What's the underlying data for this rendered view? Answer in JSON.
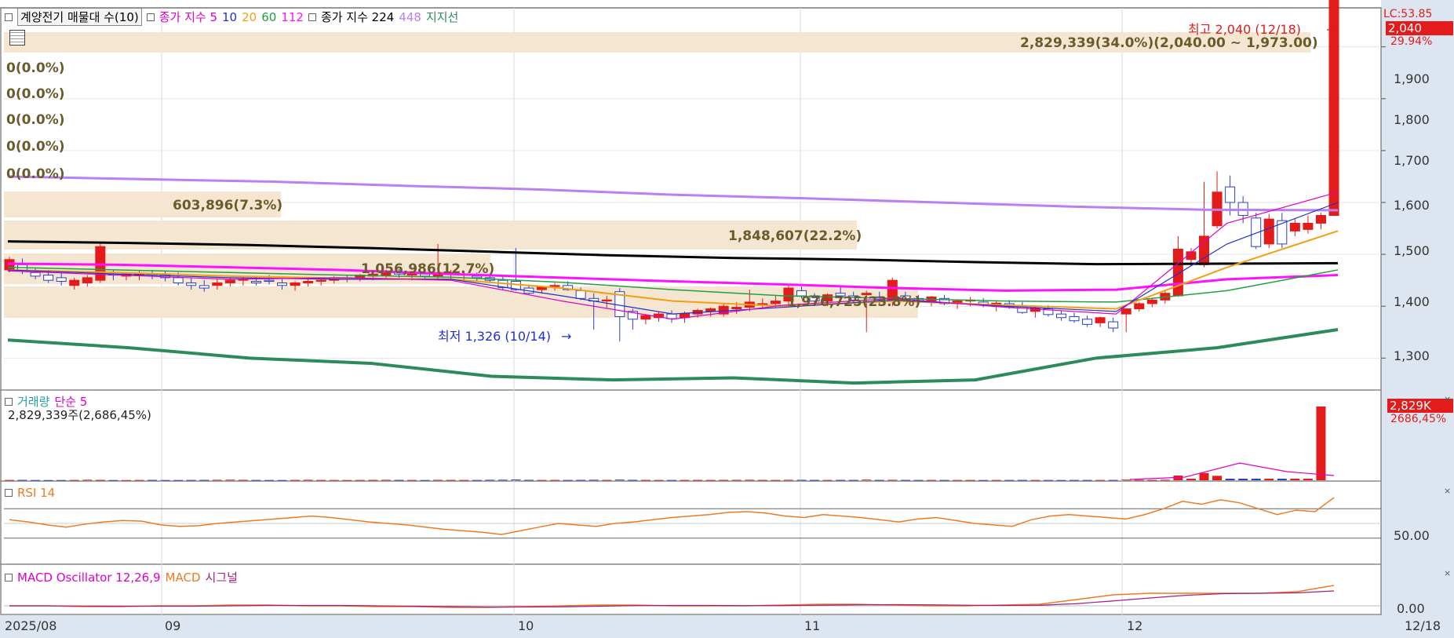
{
  "legend_top": {
    "item1": "계양전기 매물대 수(10)",
    "item2": "종가 지수 5",
    "item3": "10",
    "item4": "20",
    "item5": "60",
    "item6": "112",
    "item7": "종가 지수 224",
    "item8": "448",
    "item9": "지지선"
  },
  "volume_legend": {
    "label": "거래량",
    "ma": "단순 5",
    "value": "2,829,339주(2,686,45%)"
  },
  "rsi_legend": {
    "label": "RSI 14"
  },
  "macd_legend": {
    "label1": "MACD Oscillator 12,26,9",
    "label2": "MACD",
    "label3": "시그널"
  },
  "annotations": {
    "high": "최고 2,040 (12/18)",
    "low": "최저 1,326 (10/14)"
  },
  "right_tags": {
    "lc": "LC:53.85",
    "price": "2,040",
    "pct": "29.94%",
    "vol": "2,829K",
    "vol_pct": "2686,45%",
    "rsi_level": "50.00",
    "macd_zero": "0.00"
  },
  "colors": {
    "up": "#e31b1b",
    "down": "#2c3fc4",
    "ma5": "#e000c8",
    "ma10": "#2030d0",
    "ma20": "#f0a010",
    "ma60": "#20a040",
    "ma112": "#ff10ff",
    "ma224": "#000000",
    "ma448": "#b880f0",
    "support": "#2d8a5a",
    "box": "#f5e6d2",
    "rsi": "#f07a20"
  },
  "chart_data": {
    "type": "candlestick",
    "price_axis": {
      "ticks": [
        1300,
        1400,
        1500,
        1600,
        1700,
        1800,
        1900
      ],
      "tick_labels": [
        "1,300",
        "1,400",
        "1,500",
        "1,600",
        "1,700",
        "1,800",
        "1,900"
      ],
      "range": [
        1240,
        1960
      ]
    },
    "x_labels": [
      "2025/08",
      "09",
      "10",
      "11",
      "12",
      "12/18"
    ],
    "volume_profile": [
      {
        "label": "2,829,339(34.0%)(2,040.00 ~ 1,973.00)",
        "range": [
          1973,
          2040
        ],
        "pct": 34.0
      },
      {
        "label": "0(0.0%)",
        "pct": 0.0
      },
      {
        "label": "0(0.0%)",
        "pct": 0.0
      },
      {
        "label": "0(0.0%)",
        "pct": 0.0
      },
      {
        "label": "0(0.0%)",
        "pct": 0.0
      },
      {
        "label": "0(0.0%)",
        "pct": 0.0
      },
      {
        "label": "603,896(7.3%)",
        "pct": 7.3
      },
      {
        "label": "1,848,607(22.2%)",
        "pct": 22.2
      },
      {
        "label": "1,056,986(12.7%)",
        "pct": 12.7
      },
      {
        "label": "1,976,725(23.8%)",
        "pct": 23.8
      }
    ],
    "candles_ohlc": [
      [
        1470,
        1495,
        1465,
        1490
      ],
      [
        1480,
        1492,
        1462,
        1470
      ],
      [
        1465,
        1475,
        1452,
        1458
      ],
      [
        1460,
        1470,
        1445,
        1450
      ],
      [
        1455,
        1465,
        1440,
        1448
      ],
      [
        1440,
        1455,
        1432,
        1450
      ],
      [
        1445,
        1460,
        1438,
        1455
      ],
      [
        1450,
        1520,
        1445,
        1515
      ],
      [
        1462,
        1470,
        1450,
        1460
      ],
      [
        1458,
        1466,
        1450,
        1462
      ],
      [
        1460,
        1468,
        1450,
        1463
      ],
      [
        1462,
        1470,
        1452,
        1460
      ],
      [
        1460,
        1468,
        1448,
        1455
      ],
      [
        1455,
        1465,
        1440,
        1445
      ],
      [
        1445,
        1455,
        1432,
        1440
      ],
      [
        1440,
        1450,
        1428,
        1435
      ],
      [
        1440,
        1452,
        1432,
        1445
      ],
      [
        1445,
        1455,
        1438,
        1450
      ],
      [
        1450,
        1458,
        1440,
        1452
      ],
      [
        1448,
        1456,
        1440,
        1445
      ],
      [
        1450,
        1460,
        1442,
        1448
      ],
      [
        1445,
        1452,
        1432,
        1440
      ],
      [
        1440,
        1448,
        1430,
        1445
      ],
      [
        1445,
        1452,
        1438,
        1448
      ],
      [
        1448,
        1455,
        1440,
        1450
      ],
      [
        1450,
        1458,
        1444,
        1455
      ],
      [
        1452,
        1460,
        1446,
        1455
      ],
      [
        1455,
        1462,
        1448,
        1460
      ],
      [
        1458,
        1465,
        1450,
        1462
      ],
      [
        1460,
        1470,
        1452,
        1468
      ],
      [
        1465,
        1472,
        1455,
        1462
      ],
      [
        1460,
        1468,
        1450,
        1465
      ],
      [
        1462,
        1468,
        1452,
        1458
      ],
      [
        1458,
        1520,
        1450,
        1465
      ],
      [
        1462,
        1470,
        1452,
        1465
      ],
      [
        1460,
        1468,
        1450,
        1462
      ],
      [
        1458,
        1465,
        1448,
        1455
      ],
      [
        1455,
        1462,
        1445,
        1450
      ],
      [
        1450,
        1458,
        1432,
        1436
      ],
      [
        1448,
        1512,
        1430,
        1432
      ],
      [
        1435,
        1442,
        1422,
        1425
      ],
      [
        1432,
        1440,
        1424,
        1438
      ],
      [
        1438,
        1445,
        1430,
        1440
      ],
      [
        1440,
        1448,
        1430,
        1432
      ],
      [
        1430,
        1436,
        1412,
        1415
      ],
      [
        1415,
        1425,
        1355,
        1410
      ],
      [
        1410,
        1420,
        1395,
        1412
      ],
      [
        1428,
        1435,
        1332,
        1380
      ],
      [
        1390,
        1395,
        1355,
        1375
      ],
      [
        1375,
        1385,
        1365,
        1382
      ],
      [
        1378,
        1390,
        1370,
        1385
      ],
      [
        1385,
        1392,
        1368,
        1376
      ],
      [
        1378,
        1390,
        1368,
        1386
      ],
      [
        1385,
        1395,
        1378,
        1392
      ],
      [
        1390,
        1398,
        1380,
        1395
      ],
      [
        1385,
        1405,
        1380,
        1400
      ],
      [
        1395,
        1408,
        1385,
        1398
      ],
      [
        1398,
        1432,
        1390,
        1408
      ],
      [
        1402,
        1415,
        1395,
        1405
      ],
      [
        1405,
        1420,
        1398,
        1410
      ],
      [
        1410,
        1440,
        1402,
        1435
      ],
      [
        1430,
        1438,
        1415,
        1420
      ],
      [
        1420,
        1425,
        1405,
        1410
      ],
      [
        1410,
        1425,
        1400,
        1422
      ],
      [
        1425,
        1438,
        1415,
        1420
      ],
      [
        1420,
        1428,
        1408,
        1412
      ],
      [
        1422,
        1430,
        1350,
        1425
      ],
      [
        1418,
        1428,
        1402,
        1412
      ],
      [
        1410,
        1455,
        1400,
        1450
      ],
      [
        1420,
        1428,
        1408,
        1412
      ],
      [
        1415,
        1422,
        1405,
        1410
      ],
      [
        1410,
        1420,
        1400,
        1418
      ],
      [
        1415,
        1422,
        1402,
        1405
      ],
      [
        1405,
        1412,
        1395,
        1410
      ],
      [
        1410,
        1418,
        1400,
        1412
      ],
      [
        1408,
        1416,
        1398,
        1402
      ],
      [
        1400,
        1410,
        1390,
        1406
      ],
      [
        1405,
        1412,
        1395,
        1398
      ],
      [
        1400,
        1408,
        1385,
        1388
      ],
      [
        1390,
        1400,
        1378,
        1396
      ],
      [
        1395,
        1402,
        1380,
        1384
      ],
      [
        1385,
        1392,
        1372,
        1378
      ],
      [
        1380,
        1388,
        1368,
        1372
      ],
      [
        1375,
        1382,
        1360,
        1365
      ],
      [
        1368,
        1380,
        1360,
        1378
      ],
      [
        1370,
        1378,
        1350,
        1358
      ],
      [
        1385,
        1395,
        1350,
        1395
      ],
      [
        1395,
        1408,
        1390,
        1405
      ],
      [
        1405,
        1415,
        1398,
        1412
      ],
      [
        1412,
        1430,
        1405,
        1425
      ],
      [
        1420,
        1535,
        1418,
        1510
      ],
      [
        1490,
        1512,
        1478,
        1505
      ],
      [
        1480,
        1640,
        1475,
        1535
      ],
      [
        1555,
        1660,
        1550,
        1620
      ],
      [
        1630,
        1652,
        1575,
        1600
      ],
      [
        1600,
        1612,
        1560,
        1575
      ],
      [
        1570,
        1580,
        1510,
        1515
      ],
      [
        1520,
        1578,
        1512,
        1568
      ],
      [
        1565,
        1580,
        1512,
        1520
      ],
      [
        1545,
        1568,
        1535,
        1560
      ],
      [
        1548,
        1575,
        1540,
        1560
      ],
      [
        1560,
        1580,
        1548,
        1575
      ],
      [
        1575,
        2040,
        1575,
        2040
      ]
    ],
    "moving_averages": {
      "ma224": [
        1525,
        1482
      ],
      "ma448": [
        1650,
        1585
      ]
    },
    "support_line": [
      1335,
      1320,
      1300,
      1290,
      1265,
      1258,
      1262,
      1252,
      1258,
      1300,
      1320,
      1355
    ],
    "volume_last": 2829339,
    "volume_pct_last": 2686.45,
    "rsi_range": [
      0,
      100
    ],
    "rsi_level_line": 50.0,
    "macd_zero": 0.0
  }
}
